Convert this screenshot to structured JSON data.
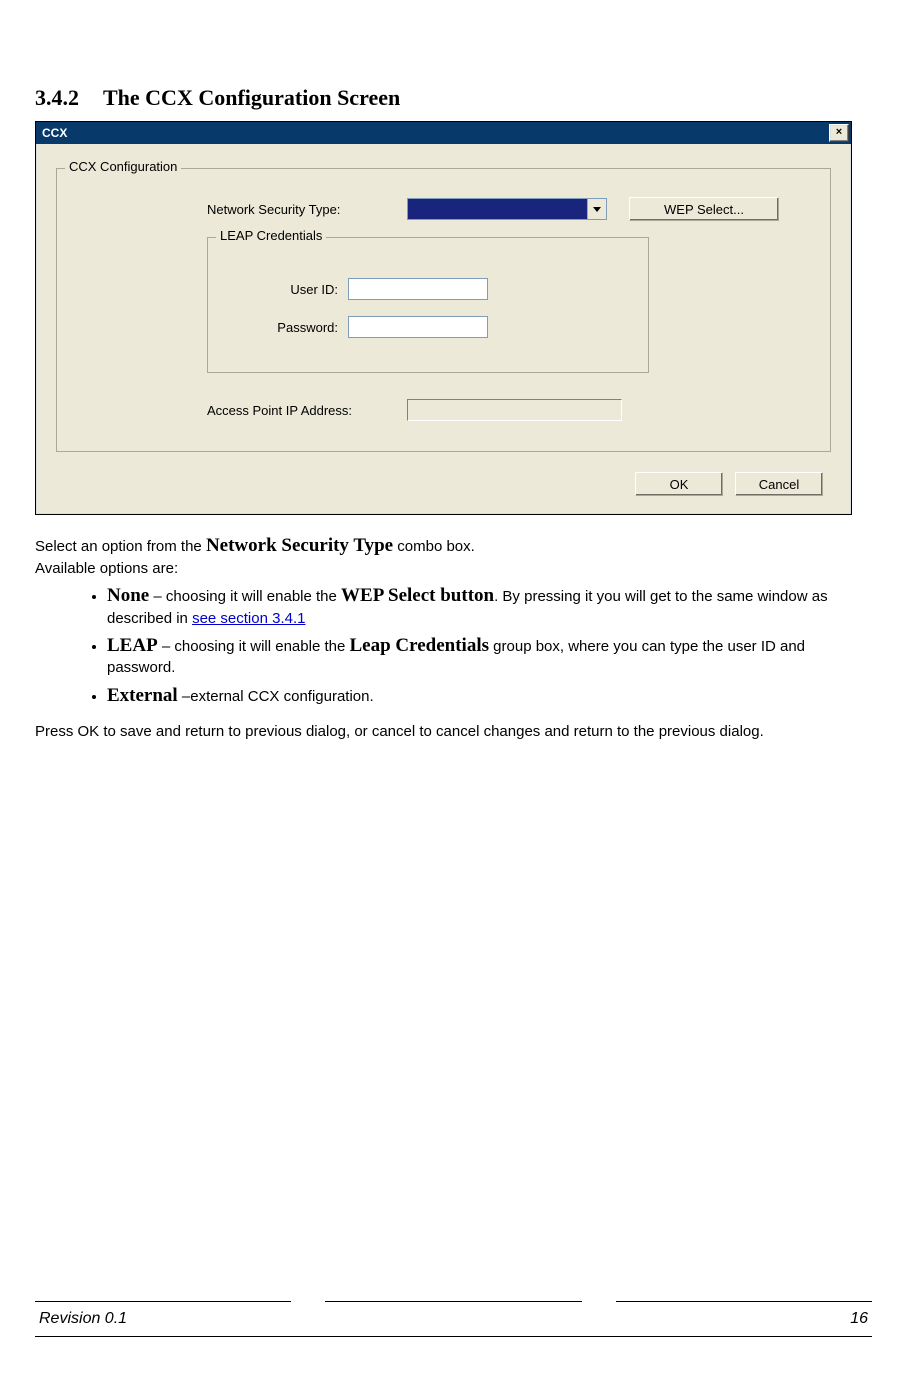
{
  "heading": {
    "number": "3.4.2",
    "title": "The CCX Configuration Screen"
  },
  "dialog": {
    "title": "CCX",
    "close_glyph": "×",
    "group_ccx": {
      "legend": "CCX Configuration",
      "security_type_label": "Network Security Type:",
      "security_type_value": "",
      "wep_select_label": "WEP Select...",
      "leap_group": {
        "legend": "LEAP Credentials",
        "userid_label": "User ID:",
        "userid_value": "",
        "password_label": "Password:",
        "password_value": ""
      },
      "ap_ip_label": "Access Point IP Address:",
      "ap_ip_value": ""
    },
    "ok_label": "OK",
    "cancel_label": "Cancel"
  },
  "body": {
    "p1_a": "Select an option from the ",
    "p1_bold": "Network Security Type",
    "p1_b": " combo box.",
    "p2": "Available options are:",
    "li1": {
      "bold": "None",
      "t1": " – choosing it will enable the ",
      "bold2": "WEP Select button",
      "t2": ".  By pressing it you will get to the same window as described in ",
      "link": "see section 3.4.1"
    },
    "li2": {
      "bold": "LEAP",
      "t1": " – choosing it will enable the ",
      "bold2": "Leap Credentials",
      "t2": " group box, where you can type the user ID and password."
    },
    "li3": {
      "bold": "External",
      "t1": " –external CCX configuration."
    },
    "p3": "Press OK to save and return to previous dialog, or cancel to cancel changes and return to the previous dialog."
  },
  "footer": {
    "revision": "Revision 0.1",
    "page": "16"
  }
}
